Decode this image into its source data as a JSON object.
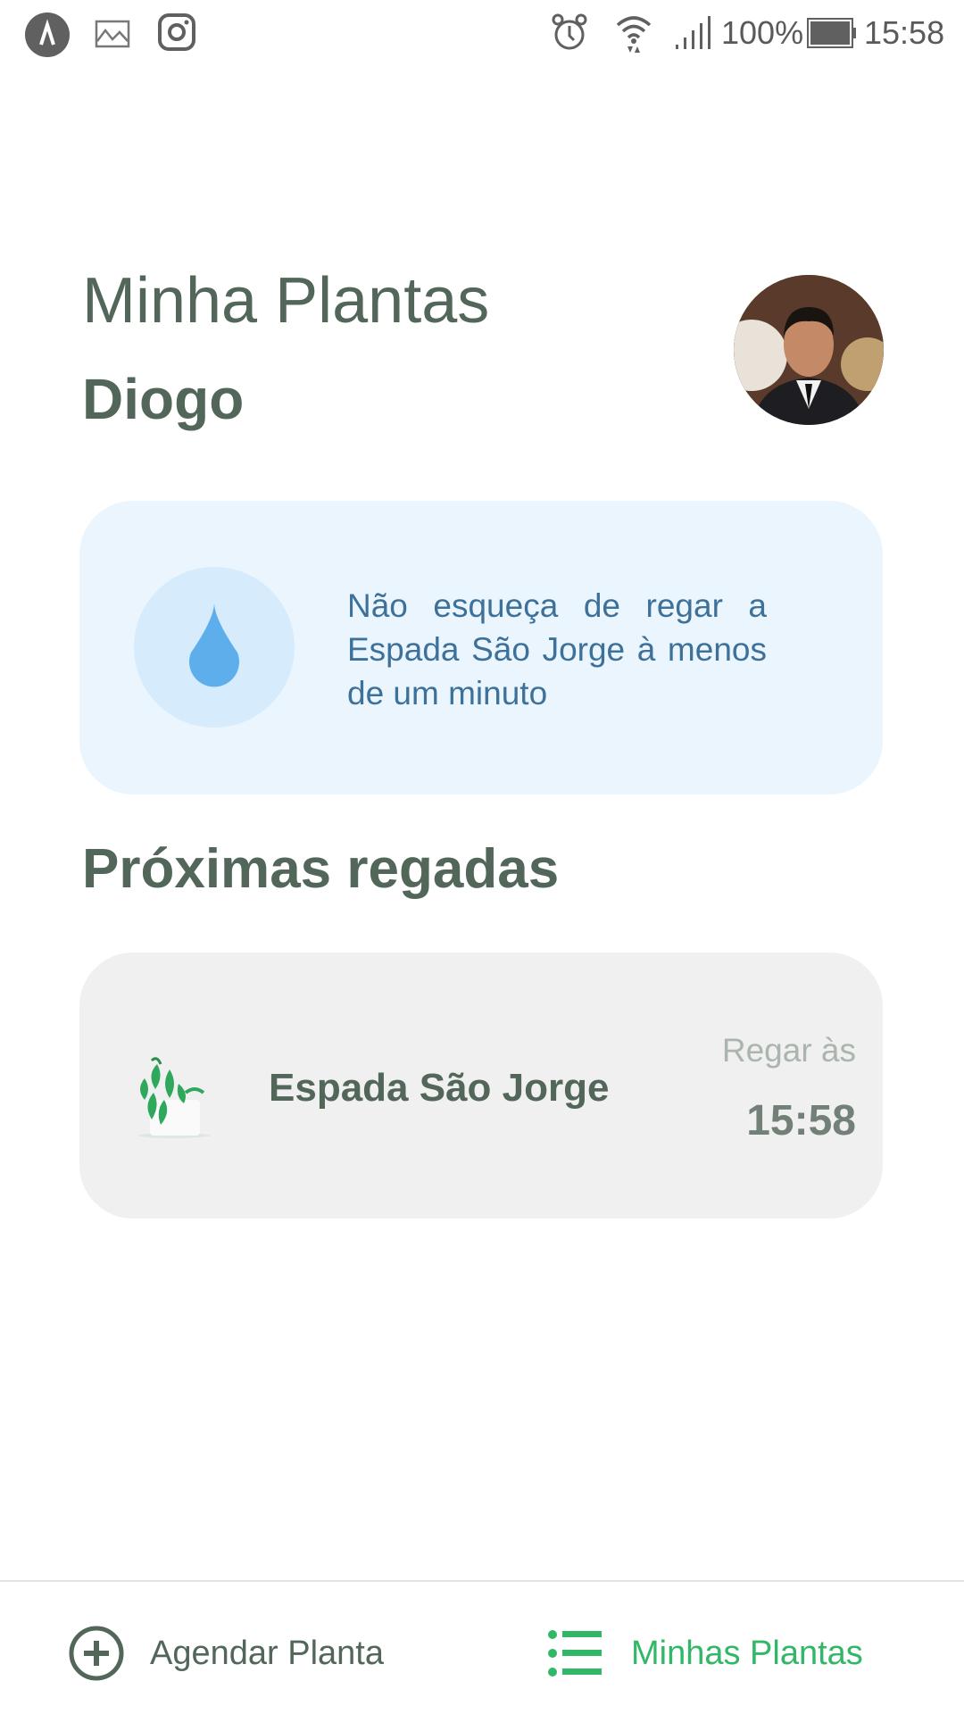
{
  "status_bar": {
    "battery": "100%",
    "time": "15:58",
    "icons": [
      "app-icon",
      "gallery-icon",
      "instagram-icon",
      "alarm-icon",
      "wifi-icon",
      "signal-icon",
      "battery-icon"
    ]
  },
  "header": {
    "title": "Minha Plantas",
    "user_name": "Diogo"
  },
  "alert": {
    "icon": "water-drop-icon",
    "message": "Não esqueça de regar a Espada São Jorge à menos de um minuto"
  },
  "section": {
    "title": "Próximas regadas"
  },
  "plants": [
    {
      "name": "Espada São Jorge",
      "time_label": "Regar às",
      "time": "15:58"
    }
  ],
  "tab_bar": {
    "items": [
      {
        "label": "Agendar Planta",
        "icon": "add-circle-icon",
        "active": false
      },
      {
        "label": "Minhas Plantas",
        "icon": "list-icon",
        "active": true
      }
    ]
  },
  "colors": {
    "heading": "#52665a",
    "accent": "#32b768",
    "alert_bg": "#ebf5fe",
    "alert_text": "#3d7199"
  }
}
